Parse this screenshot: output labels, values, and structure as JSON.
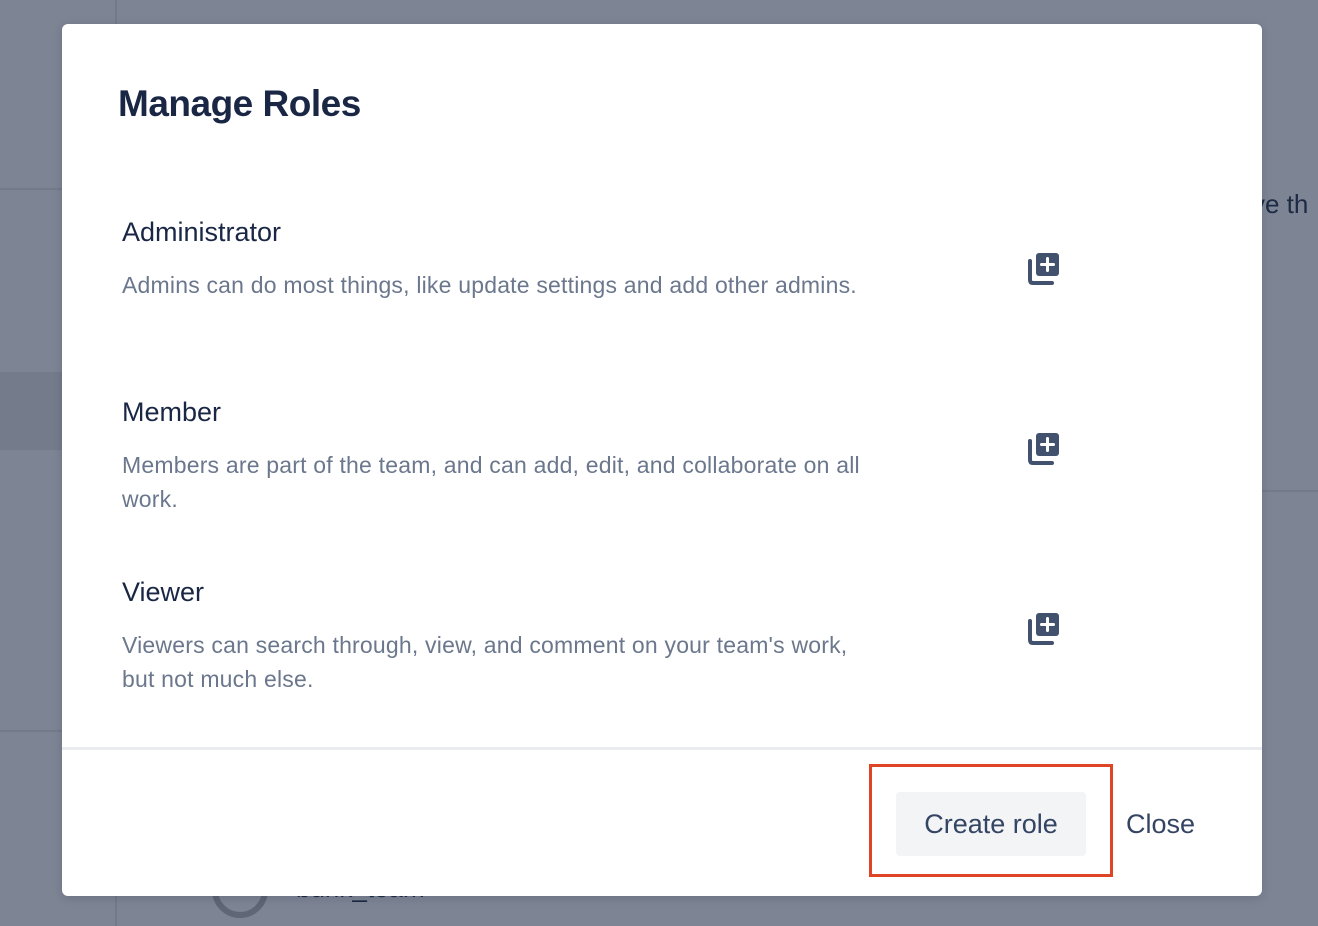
{
  "background": {
    "partial_text_right": "ve th",
    "partial_username": "bunk_team"
  },
  "modal": {
    "title": "Manage Roles",
    "roles": [
      {
        "name": "Administrator",
        "description": "Admins can do most things, like update settings and add other admins.",
        "action_icon": "duplicate-icon"
      },
      {
        "name": "Member",
        "description": "Members are part of the team, and can add, edit, and collaborate on all work.",
        "action_icon": "duplicate-icon"
      },
      {
        "name": "Viewer",
        "description": "Viewers can search through, view, and comment on your team's work, but not much else.",
        "action_icon": "duplicate-icon"
      }
    ],
    "footer": {
      "create_label": "Create role",
      "close_label": "Close"
    }
  },
  "colors": {
    "overlay": "#7d8595",
    "title_text": "#1a2744",
    "description_text": "#6b778c",
    "button_bg": "#f3f4f6",
    "highlight_border": "#e04427"
  }
}
